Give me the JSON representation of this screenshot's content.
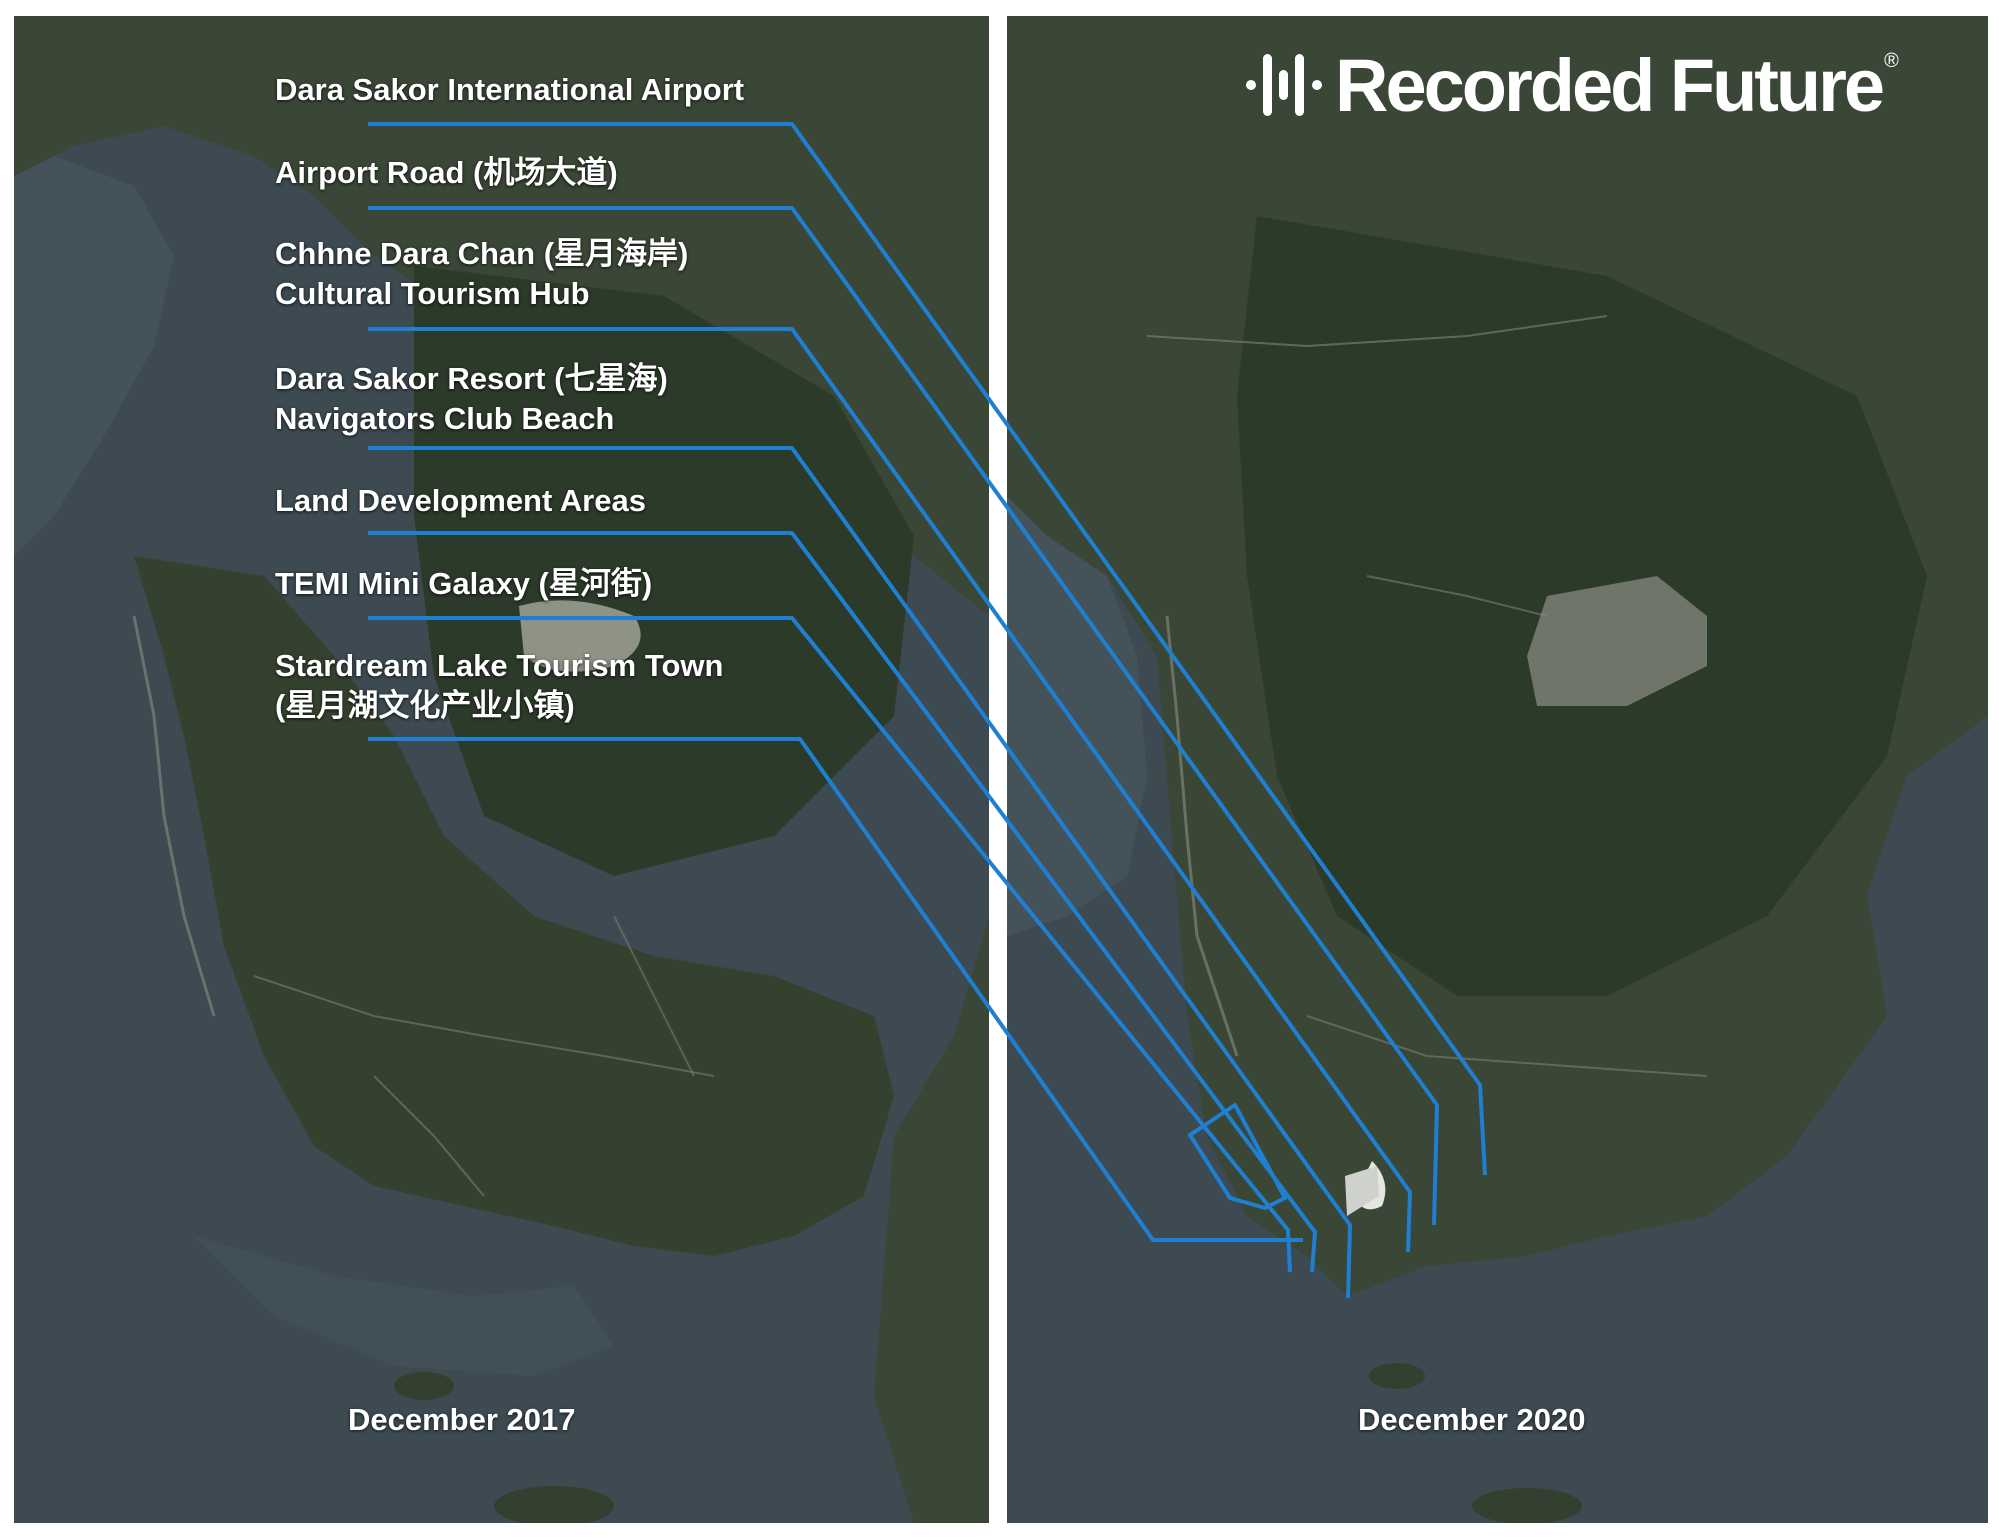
{
  "brand": {
    "name": "Recorded Future",
    "registered_mark": "®"
  },
  "panels": {
    "left": {
      "date": "December 2017"
    },
    "right": {
      "date": "December 2020"
    }
  },
  "labels": [
    {
      "lines": [
        "Dara Sakor International Airport"
      ]
    },
    {
      "lines": [
        "Airport Road (机场大道)"
      ]
    },
    {
      "lines": [
        "Chhne Dara Chan (星月海岸)",
        "Cultural Tourism Hub"
      ]
    },
    {
      "lines": [
        "Dara Sakor Resort (七星海)",
        "Navigators Club Beach"
      ]
    },
    {
      "lines": [
        "Land Development Areas"
      ]
    },
    {
      "lines": [
        "TEMI Mini Galaxy (星河街)"
      ]
    },
    {
      "lines": [
        "Stardream Lake Tourism Town",
        "(星月湖文化产业小镇)"
      ]
    }
  ],
  "colors": {
    "leader_line": "#1f7fd1",
    "sea": "#3c4a52",
    "land": "#3a4636",
    "forest": "#2c3a2a",
    "label_text": "#ffffff"
  }
}
